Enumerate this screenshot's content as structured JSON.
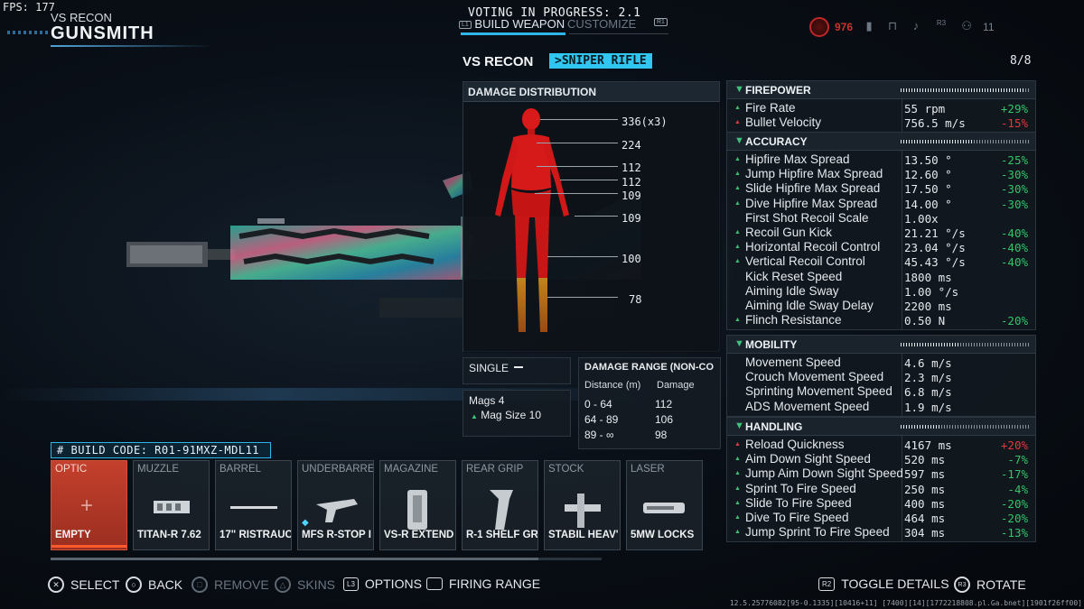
{
  "hud": {
    "fps": "FPS: 177"
  },
  "header": {
    "subtitle": "VS RECON",
    "title": "GUNSMITH"
  },
  "top_center": {
    "voting": "VOTING IN PROGRESS: 2.1",
    "tabs": [
      {
        "label": "BUILD WEAPON",
        "button": "L1",
        "active": true
      },
      {
        "label": "CUSTOMIZE",
        "button": "R1",
        "active": false
      }
    ]
  },
  "top_right": {
    "threat_value": "976",
    "count": "11",
    "r3_label": "R3"
  },
  "weapon": {
    "name": "VS RECON",
    "class": ">SNIPER RIFLE",
    "count": "8/8"
  },
  "damage_distribution": {
    "title": "DAMAGE DISTRIBUTION",
    "labels": [
      "336(x3)",
      "224",
      "112",
      "112",
      "109",
      "109",
      "100",
      "78"
    ]
  },
  "fire_mode": "SINGLE",
  "mags": {
    "mags_label": "Mags",
    "mags_value": "4",
    "mag_size_label": "Mag Size",
    "mag_size_value": "10"
  },
  "damage_range": {
    "title": "DAMAGE RANGE  (NON-CO",
    "col_distance": "Distance (m)",
    "col_damage": "Damage",
    "rows": [
      {
        "distance": "0 - 64",
        "damage": "112"
      },
      {
        "distance": "64 - 89",
        "damage": "106"
      },
      {
        "distance": "89 - ∞",
        "damage": "98"
      }
    ]
  },
  "stats": {
    "firepower": {
      "title": "FIREPOWER",
      "level": 0.95,
      "rows": [
        {
          "label": "Fire Rate",
          "value": "55 rpm",
          "delta": "+29%",
          "trend": "up",
          "good": true
        },
        {
          "label": "Bullet Velocity",
          "value": "756.5 m/s",
          "delta": "-15%",
          "trend": "down",
          "good": false
        }
      ]
    },
    "accuracy": {
      "title": "ACCURACY",
      "level": 0.55,
      "rows": [
        {
          "label": "Hipfire Max Spread",
          "value": "13.50 °",
          "delta": "-25%",
          "trend": "up",
          "good": true
        },
        {
          "label": "Jump Hipfire Max Spread",
          "value": "12.60 °",
          "delta": "-30%",
          "trend": "up",
          "good": true
        },
        {
          "label": "Slide Hipfire Max Spread",
          "value": "17.50 °",
          "delta": "-30%",
          "trend": "up",
          "good": true
        },
        {
          "label": "Dive Hipfire Max Spread",
          "value": "14.00 °",
          "delta": "-30%",
          "trend": "up",
          "good": true
        },
        {
          "label": "First Shot Recoil Scale",
          "value": "1.00x",
          "delta": "",
          "trend": "none",
          "good": true
        },
        {
          "label": "Recoil Gun Kick",
          "value": "21.21 °/s",
          "delta": "-40%",
          "trend": "up",
          "good": true
        },
        {
          "label": "Horizontal Recoil Control",
          "value": "23.04 °/s",
          "delta": "-40%",
          "trend": "up",
          "good": true
        },
        {
          "label": "Vertical Recoil Control",
          "value": "45.43 °/s",
          "delta": "-40%",
          "trend": "up",
          "good": true
        },
        {
          "label": "Kick Reset Speed",
          "value": "1800 ms",
          "delta": "",
          "trend": "none",
          "good": true
        },
        {
          "label": "Aiming Idle Sway",
          "value": "1.00 °/s",
          "delta": "",
          "trend": "none",
          "good": true
        },
        {
          "label": "Aiming Idle Sway Delay",
          "value": "2200 ms",
          "delta": "",
          "trend": "none",
          "good": true
        },
        {
          "label": "Flinch Resistance",
          "value": "0.50 N",
          "delta": "-20%",
          "trend": "up",
          "good": true
        }
      ]
    },
    "mobility": {
      "title": "MOBILITY",
      "level": 0.45,
      "rows": [
        {
          "label": "Movement Speed",
          "value": "4.6 m/s",
          "delta": "",
          "trend": "none",
          "good": true
        },
        {
          "label": "Crouch Movement Speed",
          "value": "2.3 m/s",
          "delta": "",
          "trend": "none",
          "good": true
        },
        {
          "label": "Sprinting Movement Speed",
          "value": "6.8 m/s",
          "delta": "",
          "trend": "none",
          "good": true
        },
        {
          "label": "ADS Movement Speed",
          "value": "1.9 m/s",
          "delta": "",
          "trend": "none",
          "good": true
        }
      ]
    },
    "handling": {
      "title": "HANDLING",
      "level": 0.3,
      "rows": [
        {
          "label": "Reload Quickness",
          "value": "4167 ms",
          "delta": "+20%",
          "trend": "down",
          "good": false
        },
        {
          "label": "Aim Down Sight Speed",
          "value": "520 ms",
          "delta": "-7%",
          "trend": "up",
          "good": true
        },
        {
          "label": "Jump Aim Down Sight Speed",
          "value": "597 ms",
          "delta": "-17%",
          "trend": "up",
          "good": true
        },
        {
          "label": "Sprint To Fire Speed",
          "value": "250 ms",
          "delta": "-4%",
          "trend": "up",
          "good": true
        },
        {
          "label": "Slide To Fire Speed",
          "value": "400 ms",
          "delta": "-20%",
          "trend": "up",
          "good": true
        },
        {
          "label": "Dive To Fire Speed",
          "value": "464 ms",
          "delta": "-20%",
          "trend": "up",
          "good": true
        },
        {
          "label": "Jump Sprint To Fire Speed",
          "value": "304 ms",
          "delta": "-13%",
          "trend": "up",
          "good": true
        }
      ]
    }
  },
  "build_code": "BUILD CODE: R01-91MXZ-MDL11",
  "slots": [
    {
      "category": "OPTIC",
      "part": "EMPTY",
      "active": true,
      "icon": "plus-icon"
    },
    {
      "category": "MUZZLE",
      "part": "TITAN-R 7.62",
      "active": false,
      "icon": "muzzle-icon"
    },
    {
      "category": "BARREL",
      "part": "17\" RISTRAUC",
      "active": false,
      "icon": "barrel-icon"
    },
    {
      "category": "UNDERBARRE",
      "part": "MFS R-STOP I",
      "active": false,
      "icon": "underbarrel-icon",
      "tagged": true
    },
    {
      "category": "MAGAZINE",
      "part": "VS-R EXTEND",
      "active": false,
      "icon": "magazine-icon"
    },
    {
      "category": "REAR GRIP",
      "part": "R-1 SHELF GR",
      "active": false,
      "icon": "grip-icon"
    },
    {
      "category": "STOCK",
      "part": "STABIL HEAV'",
      "active": false,
      "icon": "stock-icon"
    },
    {
      "category": "LASER",
      "part": "5MW LOCKS",
      "active": false,
      "icon": "laser-icon"
    }
  ],
  "bottom_hints": [
    {
      "button": "cross-button",
      "label": "SELECT",
      "enabled": true
    },
    {
      "button": "circle-button",
      "label": "BACK",
      "enabled": true
    },
    {
      "button": "square-button",
      "label": "REMOVE",
      "enabled": false
    },
    {
      "button": "triangle-button",
      "label": "SKINS",
      "enabled": false
    },
    {
      "button": "L3",
      "label": "OPTIONS",
      "enabled": true
    },
    {
      "button": "touchpad-button",
      "label": "FIRING RANGE",
      "enabled": true
    },
    {
      "button": "R2",
      "label": "TOGGLE DETAILS",
      "enabled": true
    },
    {
      "button": "R3",
      "label": "ROTATE",
      "enabled": true
    }
  ],
  "build_string": "12.5.25776082[95-0.1335][10416+11] [7400][14][1772218808.pl.Ga.bnet][1901f26ff00]",
  "colors": {
    "accent": "#31c6ef",
    "positive": "#35c46a",
    "negative": "#e0393b",
    "slot_active": "#c4402c"
  }
}
